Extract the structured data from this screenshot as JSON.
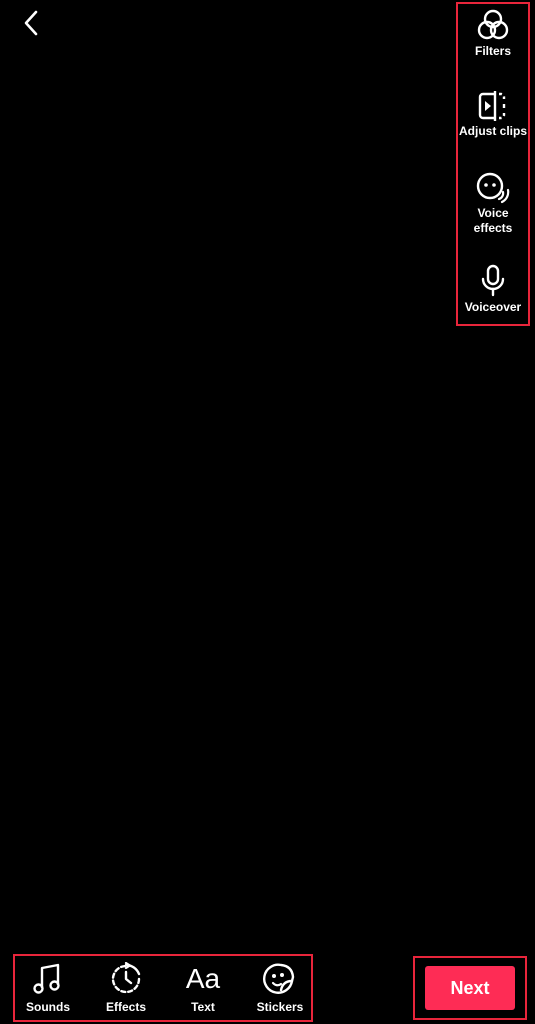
{
  "right_panel": {
    "items": [
      {
        "label": "Filters",
        "icon": "filters-icon"
      },
      {
        "label": "Adjust clips",
        "icon": "adjust-clips-icon"
      },
      {
        "label": "Voice\neffects",
        "icon": "voice-effects-icon"
      },
      {
        "label": "Voiceover",
        "icon": "microphone-icon"
      }
    ]
  },
  "bottom_bar": {
    "items": [
      {
        "label": "Sounds",
        "icon": "music-note-icon"
      },
      {
        "label": "Effects",
        "icon": "effects-timer-icon"
      },
      {
        "label": "Text",
        "icon": "text-aa-icon",
        "glyph": "Aa"
      },
      {
        "label": "Stickers",
        "icon": "sticker-icon"
      }
    ]
  },
  "next_label": "Next",
  "colors": {
    "background": "#000000",
    "accent": "#fe2c55",
    "highlight_border": "#e8253b",
    "text": "#ffffff"
  }
}
